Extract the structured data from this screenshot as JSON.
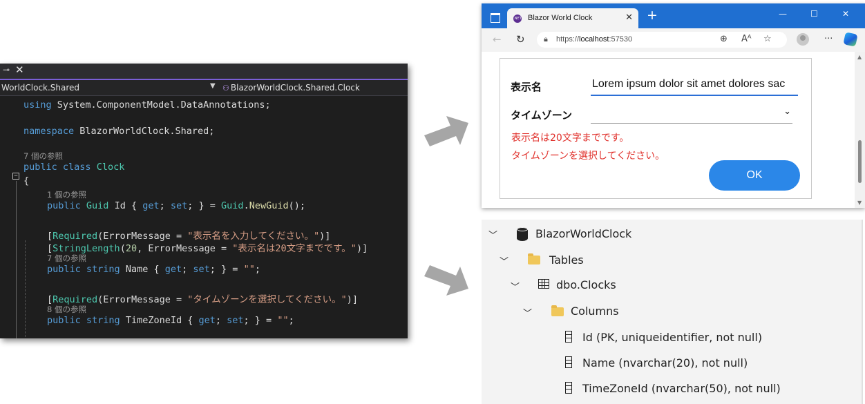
{
  "editor": {
    "left_combo": "WorldClock.Shared",
    "right_combo": "BlazorWorldClock.Shared.Clock",
    "lines": {
      "using": [
        "using",
        " System.ComponentModel.DataAnnotations;"
      ],
      "namespace": [
        "namespace",
        " BlazorWorldClock.Shared;"
      ],
      "ref_class": "7 個の参照",
      "class_decl": [
        "public",
        " ",
        "class",
        " ",
        "Clock"
      ],
      "open_brace": "{",
      "ref_id": "1 個の参照",
      "id_line": [
        "public",
        " ",
        "Guid",
        " Id { ",
        "get",
        "; ",
        "set",
        "; } = ",
        "Guid",
        ".",
        "NewGuid",
        "();"
      ],
      "req_name": [
        "[",
        "Required",
        "(ErrorMessage = ",
        "\"表示名を入力してください。\"",
        ")]"
      ],
      "strlen": [
        "[",
        "StringLength",
        "(",
        "20",
        ", ErrorMessage = ",
        "\"表示名は20文字までです。\"",
        ")]"
      ],
      "ref_name": "7 個の参照",
      "name_line": [
        "public",
        " ",
        "string",
        " Name { ",
        "get",
        "; ",
        "set",
        "; } = ",
        "\"\"",
        ";"
      ],
      "req_tz": [
        "[",
        "Required",
        "(ErrorMessage = ",
        "\"タイムゾーンを選択してください。\"",
        ")]"
      ],
      "ref_tz": "8 個の参照",
      "tz_line": [
        "public",
        " ",
        "string",
        " TimeZoneId { ",
        "get",
        "; ",
        "set",
        "; } = ",
        "\"\"",
        ";"
      ]
    }
  },
  "browser": {
    "tab_title": "Blazor World Clock",
    "favicon_text": ".NET",
    "url_prefix": "https://",
    "url_host": "localhost",
    "url_port": ":57530",
    "form": {
      "name_label": "表示名",
      "name_value": "Lorem ipsum dolor sit amet dolores sac",
      "tz_label": "タイムゾーン",
      "tz_value": "",
      "errors": [
        "表示名は20文字までです。",
        "タイムゾーンを選択してください。"
      ],
      "ok_label": "OK"
    }
  },
  "tree": {
    "database": "BlazorWorldClock",
    "tables_folder": "Tables",
    "table": "dbo.Clocks",
    "columns_folder": "Columns",
    "columns": [
      "Id (PK, uniqueidentifier, not null)",
      "Name (nvarchar(20), not null)",
      "TimeZoneId (nvarchar(50), not null)"
    ]
  },
  "colors": {
    "editor_bg": "#1e1e1e",
    "keyword": "#569cd6",
    "type": "#4ec9b0",
    "string": "#d69d85",
    "browser_titlebar": "#1f6fd1",
    "error_text": "#e0302b",
    "ok_button": "#2b87e8",
    "arrow": "#a6a6a6"
  },
  "icons": [
    "pin-icon",
    "close-icon",
    "class-icon",
    "window-icon",
    "favicon",
    "plus-icon",
    "back-icon",
    "reload-icon",
    "lock-icon",
    "zoom-icon",
    "read-aloud-icon",
    "favorite-icon",
    "avatar",
    "more-icon",
    "copilot-icon",
    "chevron-down-icon",
    "database-icon",
    "folder-icon",
    "table-icon",
    "column-icon",
    "arrow-icon"
  ]
}
